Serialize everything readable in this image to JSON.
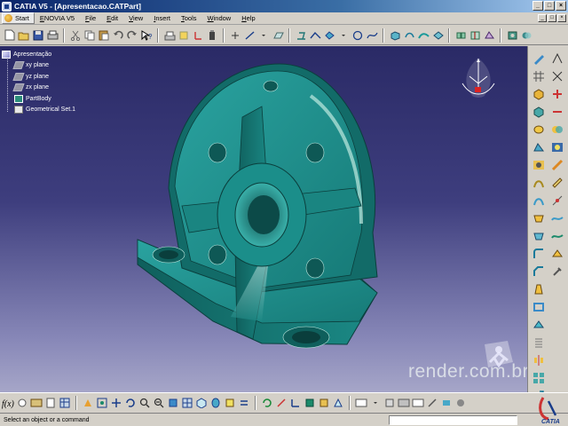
{
  "window": {
    "title": "CATIA V5 - [Apresentacao.CATPart]",
    "buttons": [
      "_",
      "□",
      "×"
    ]
  },
  "menu": {
    "start": "Start",
    "items": [
      "ENOVIA V5",
      "File",
      "Edit",
      "View",
      "Insert",
      "Tools",
      "Window",
      "Help"
    ]
  },
  "tree": {
    "root": "Apresentação",
    "items": [
      "xy plane",
      "yz plane",
      "zx plane",
      "PartBody",
      "Geometrical Set.1"
    ]
  },
  "viewport": {
    "watermark": "render.com.br",
    "part_color": "#1e8a86",
    "background_top": "#2a2a66",
    "background_bottom": "#a6a6c8"
  },
  "status": {
    "message": "Select an object or a command"
  },
  "brand": {
    "logo_text": "CATIA"
  }
}
